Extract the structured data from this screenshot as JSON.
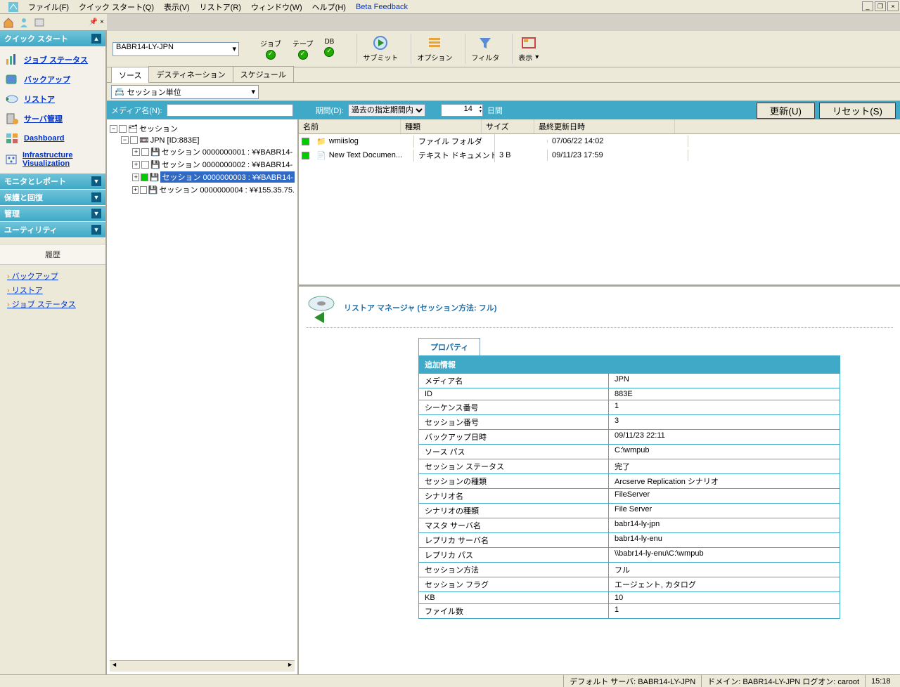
{
  "menu": {
    "file": "ファイル(F)",
    "quickstart": "クイック スタート(Q)",
    "view": "表示(V)",
    "restore": "リストア(R)",
    "window": "ウィンドウ(W)",
    "help": "ヘルプ(H)",
    "beta": "Beta Feedback"
  },
  "sidebar": {
    "sections": {
      "quickstart": "クイック スタート",
      "monitor": "モニタとレポート",
      "protect": "保護と回復",
      "admin": "管理",
      "utility": "ユーティリティ"
    },
    "items": [
      {
        "label": "ジョブ ステータス"
      },
      {
        "label": "バックアップ"
      },
      {
        "label": "リストア"
      },
      {
        "label": "サーバ管理"
      },
      {
        "label": "Dashboard"
      },
      {
        "label": "Infrastructure Visualization"
      }
    ],
    "history_header": "履歴",
    "history_links": [
      "バックアップ",
      "リストア",
      "ジョブ ステータス"
    ]
  },
  "toolbar": {
    "server": "BABR14-LY-JPN",
    "status": {
      "job": "ジョブ",
      "tape": "テープ",
      "db": "DB"
    },
    "buttons": {
      "submit": "サブミット",
      "option": "オプション",
      "filter": "フィルタ",
      "show": "表示"
    }
  },
  "tabs": {
    "source": "ソース",
    "dest": "デスティネーション",
    "schedule": "スケジュール"
  },
  "session_mode_icon": "📇",
  "session_mode": "セッション単位",
  "filter": {
    "media_label": "メディア名(N):",
    "media_value": "",
    "period_label": "期間(D):",
    "period_value": "過去の指定期間内",
    "days_value": "14",
    "days_unit": "日間",
    "update_btn": "更新(U)",
    "reset_btn": "リセット(S)"
  },
  "tree": {
    "root": "セッション",
    "jpn": "JPN [ID:883E]",
    "sessions": [
      "セッション 0000000001 : ¥¥BABR14-",
      "セッション 0000000002 : ¥¥BABR14-",
      "セッション 0000000003 : ¥¥BABR14-",
      "セッション 0000000004 : ¥¥155.35.75."
    ]
  },
  "filelist": {
    "headers": {
      "name": "名前",
      "type": "種類",
      "size": "サイズ",
      "date": "最終更新日時"
    },
    "rows": [
      {
        "name": "wmiislog",
        "type": "ファイル フォルダ",
        "size": "",
        "date": "07/06/22  14:02",
        "icon": "folder"
      },
      {
        "name": "New Text Documen...",
        "type": "テキスト ドキュメント",
        "size": "3 B",
        "date": "09/11/23  17:59",
        "icon": "file"
      }
    ]
  },
  "detail": {
    "title": "リストア マネージャ (セッション方法: フル)",
    "prop_tab": "プロパティ",
    "section_hdr": "追加情報",
    "rows": [
      {
        "label": "メディア名",
        "value": "JPN"
      },
      {
        "label": "ID",
        "value": "883E"
      },
      {
        "label": "シーケンス番号",
        "value": "1"
      },
      {
        "label": "セッション番号",
        "value": "3"
      },
      {
        "label": "バックアップ日時",
        "value": "09/11/23 22:11"
      },
      {
        "label": "ソース パス",
        "value": "C:\\wmpub"
      },
      {
        "label": "セッション ステータス",
        "value": "完了"
      },
      {
        "label": "セッションの種類",
        "value": "Arcserve Replication シナリオ"
      },
      {
        "label": "シナリオ名",
        "value": "FileServer"
      },
      {
        "label": "シナリオの種類",
        "value": "File Server"
      },
      {
        "label": "マスタ サーバ名",
        "value": "babr14-ly-jpn"
      },
      {
        "label": "レプリカ サーバ名",
        "value": "babr14-ly-enu"
      },
      {
        "label": "レプリカ パス",
        "value": "\\\\babr14-ly-enu\\C:\\wmpub"
      },
      {
        "label": "セッション方法",
        "value": "フル"
      },
      {
        "label": "セッション フラグ",
        "value": "エージェント, カタログ"
      },
      {
        "label": "KB",
        "value": "10"
      },
      {
        "label": "ファイル数",
        "value": "1"
      }
    ]
  },
  "status": {
    "default_server": "デフォルト サーバ: BABR14-LY-JPN",
    "domain": "ドメイン: BABR14-LY-JPN  ログオン: caroot",
    "time": "15:18"
  }
}
